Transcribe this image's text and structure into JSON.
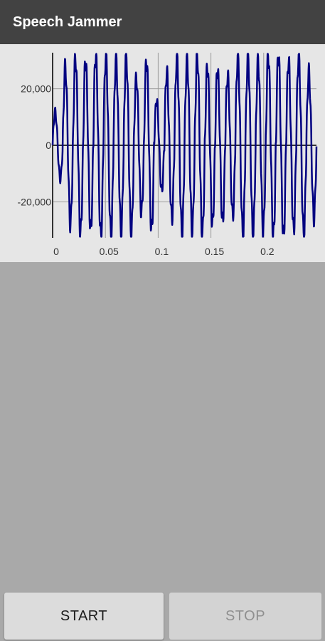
{
  "app": {
    "title": "Speech Jammer"
  },
  "colors": {
    "app_bar": "#424242",
    "chart_background": "#e6e6e6",
    "waveform": "#000080",
    "content_background": "#a9a9a9"
  },
  "chart_data": {
    "type": "line",
    "xlim": [
      0,
      0.25
    ],
    "ylim": [
      -32768,
      32767
    ],
    "x_ticks": [
      "0",
      "0.05",
      "0.1",
      "0.15",
      "0.2"
    ],
    "y_ticks": [
      "20,000",
      "0",
      "-20,000"
    ],
    "grid": true,
    "series": [
      {
        "x_start": 0,
        "x_end": 0.25,
        "peak_count": 26,
        "amplitude": 32000,
        "approx_peak_values": [
          12000,
          28000,
          31000,
          30000,
          32000,
          32000,
          31000,
          32000,
          24000,
          30000,
          16000,
          26000,
          32000,
          31000,
          32000,
          28000,
          27000,
          25000,
          32000,
          32000,
          30000,
          32000,
          32000,
          30000,
          32000,
          26000
        ]
      }
    ]
  },
  "controls": {
    "start_label": "START",
    "stop_label": "STOP",
    "stop_enabled": false
  }
}
